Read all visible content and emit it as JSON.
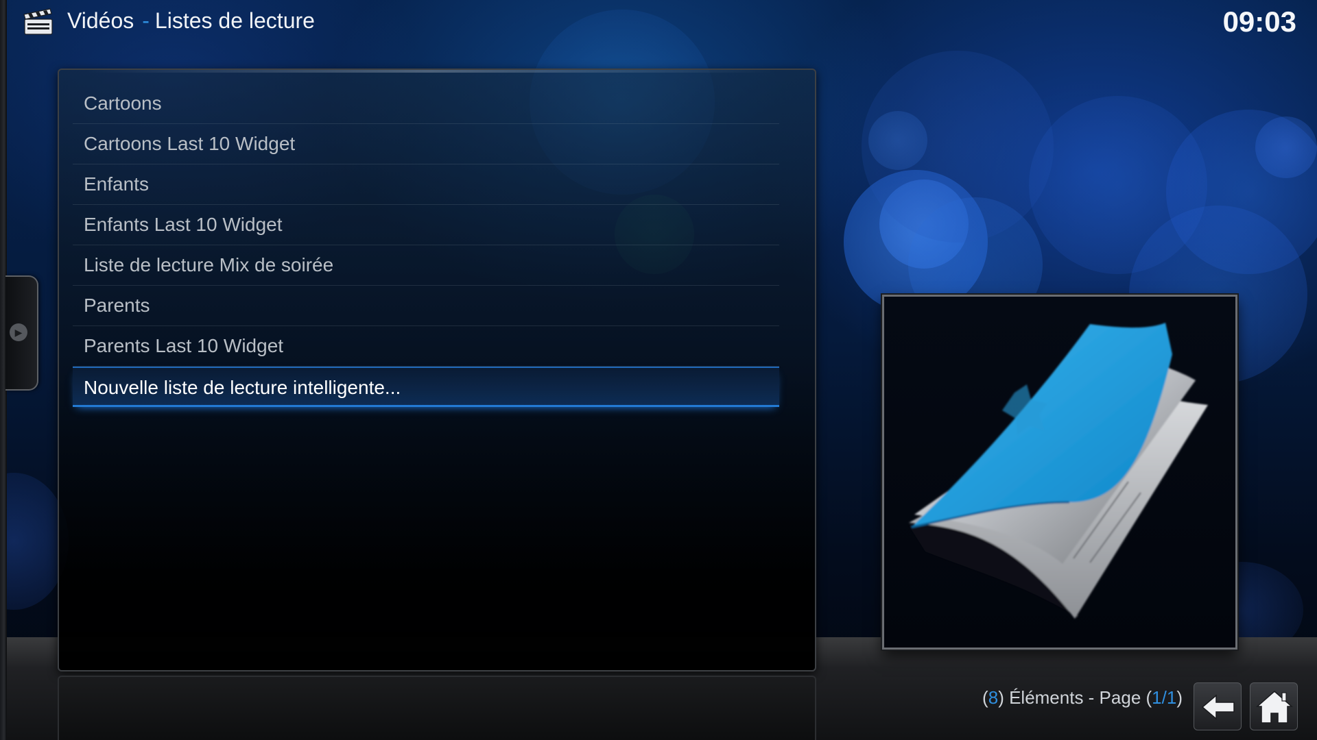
{
  "header": {
    "section": "Vidéos",
    "separator": "-",
    "subsection": "Listes de lecture",
    "icon": "clapperboard-icon"
  },
  "clock": "09:03",
  "list": {
    "items": [
      {
        "label": "Cartoons",
        "selected": false
      },
      {
        "label": "Cartoons Last 10 Widget",
        "selected": false
      },
      {
        "label": "Enfants",
        "selected": false
      },
      {
        "label": "Enfants Last 10 Widget",
        "selected": false
      },
      {
        "label": "Liste de lecture Mix de soirée",
        "selected": false
      },
      {
        "label": "Parents",
        "selected": false
      },
      {
        "label": "Parents Last 10 Widget",
        "selected": false
      },
      {
        "label": "Nouvelle liste de lecture intelligente...",
        "selected": true
      }
    ]
  },
  "thumbnail": {
    "icon": "smart-playlist-book-icon"
  },
  "footer": {
    "open_paren": "(",
    "count": "8",
    "count_suffix": ") Éléments - Page (",
    "page": "1/1",
    "close_paren": ")"
  },
  "buttons": {
    "back_icon": "back-arrow-icon",
    "home_icon": "home-icon"
  },
  "side_tab_icon": "chevron-right-icon",
  "colors": {
    "accent": "#2f8fe0",
    "text_primary": "#ffffff",
    "text_secondary": "#b9bfc6"
  }
}
